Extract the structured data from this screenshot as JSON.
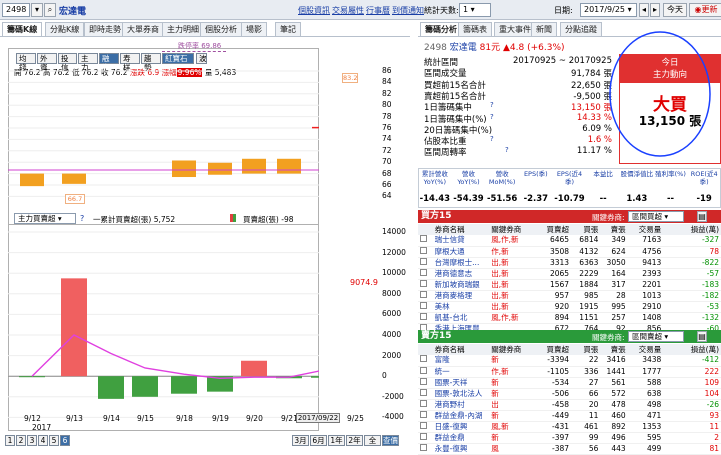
{
  "left_header": {
    "stock_id": "2498",
    "stock_name": "宏達電",
    "links": [
      "個股資訊",
      "交易屬性",
      "行事曆",
      "到價通知"
    ]
  },
  "left_tabs": [
    "籌碼K線",
    "分點K線",
    "即時走勢",
    "大單券商",
    "主力明細",
    "個股分析",
    "場影",
    "筆記"
  ],
  "chart_buttons": [
    "均錢",
    "外資",
    "投信",
    "主力",
    "融資",
    "寿样",
    "趨勢",
    "紅寶石",
    "波"
  ],
  "ohlc": {
    "open": "開 76.2",
    "high": "高 76.2",
    "low": "低 76.2",
    "close": "收 76.2",
    "change": "漲跌 6.9",
    "pct_label": "漲幅",
    "pct": "9.96%",
    "vol": "量 5,483"
  },
  "annot": {
    "limit_down": "跌停率 69.86",
    "tag_high": "83.2",
    "tag_low": "66.7"
  },
  "price_axis": [
    "86",
    "84",
    "82",
    "80",
    "78",
    "76",
    "74",
    "72",
    "70",
    "68",
    "66",
    "64"
  ],
  "lower_legend": {
    "select": "主力買賣超",
    "line": "一累計買賣超(張) 5,752",
    "bar": "買賣超(張) -98",
    "cur": "9074.9"
  },
  "lower_axis": [
    "14000",
    "12000",
    "10000",
    "8000",
    "6000",
    "4000",
    "2000",
    "0",
    "-2000",
    "-4000"
  ],
  "x_dates": [
    "9/12",
    "9/13",
    "9/14",
    "9/15",
    "9/18",
    "9/19",
    "9/20",
    "9/21",
    "9/22",
    "9/25"
  ],
  "year": "2017",
  "cursor_date": "2017/09/22",
  "pagination": {
    "pages": [
      "1",
      "2",
      "3",
      "4",
      "5",
      "6"
    ],
    "ranges": [
      "3月",
      "6月",
      "1年",
      "2年",
      "全",
      "查價"
    ]
  },
  "right_header": {
    "days_label": "統計天數:",
    "days": "1",
    "date_label": "日期:",
    "date": "2017/9/25",
    "today": "今天",
    "update": "更新"
  },
  "right_tabs": [
    "籌碼分析",
    "籌碼表",
    "重大事件",
    "新聞",
    "分點追蹤"
  ],
  "stock_line": {
    "id": "2498",
    "name": "宏達電",
    "price": "81元",
    "chg": "▲4.8 (+6.3%)"
  },
  "stats": [
    {
      "label": "統計區間",
      "value": "20170925 ~ 20170925"
    },
    {
      "label": "區間成交量",
      "value": "91,784 張"
    },
    {
      "label": "買超前15名合計",
      "value": "22,650 張"
    },
    {
      "label": "賣超前15名合計",
      "value": "-9,500 張"
    },
    {
      "label": "1日籌碼集中",
      "value": "13,150 張"
    },
    {
      "label": "1日籌碼集中(%)",
      "value": "14.33 %"
    },
    {
      "label": "20日籌碼集中(%)",
      "value": "6.09 %"
    },
    {
      "label": "佔股本比重",
      "value": "1.6 %"
    },
    {
      "label": "區間周轉率",
      "value": "11.17 %"
    }
  ],
  "today_box": {
    "t1": "今日",
    "t2": "主力動向",
    "verdict": "大買",
    "amount": "13,150 張"
  },
  "metrics_head": [
    "累計營收YoY(%)",
    "營收YoY(%)",
    "營收MoM(%)",
    "EPS(季)",
    "EPS(近4季)",
    "本益比",
    "股價淨值比",
    "殖利率(%)",
    "ROE(近4季)"
  ],
  "metrics_val": [
    "-14.43",
    "-54.39",
    "-51.56",
    "-2.37",
    "-10.79",
    "--",
    "1.43",
    "--",
    "-19"
  ],
  "buy15": {
    "title": "買方15",
    "q": "關鍵券商:",
    "select": "區間買超",
    "cols": [
      "券商名稱",
      "關鍵券商",
      "買賣超",
      "買張",
      "賣張",
      "交易量",
      "損益(萬)"
    ],
    "rows": [
      [
        "瑞士信貸",
        "風,作,新",
        "6465",
        "6814",
        "349",
        "7163",
        "-327"
      ],
      [
        "摩根大通",
        "作,新",
        "3508",
        "4132",
        "624",
        "4756",
        "78"
      ],
      [
        "台灣摩根士...",
        "出,新",
        "3313",
        "6363",
        "3050",
        "9413",
        "-822"
      ],
      [
        "港商德意志",
        "出,新",
        "2065",
        "2229",
        "164",
        "2393",
        "-57"
      ],
      [
        "新加坡商瑞銀",
        "出,新",
        "1567",
        "1884",
        "317",
        "2201",
        "-183"
      ],
      [
        "港商麥格理",
        "出,新",
        "957",
        "985",
        "28",
        "1013",
        "-182"
      ],
      [
        "美林",
        "出,新",
        "920",
        "1915",
        "995",
        "2910",
        "-53"
      ],
      [
        "凱基-台北",
        "風,作,新",
        "894",
        "1151",
        "257",
        "1408",
        "-132"
      ],
      [
        "香港上海匯豐",
        "",
        "672",
        "764",
        "92",
        "856",
        "-60"
      ]
    ]
  },
  "sell15": {
    "title": "賣方15",
    "q": "關鍵券商:",
    "select": "區間賣超",
    "cols": [
      "券商名稱",
      "關鍵券商",
      "買賣超",
      "買張",
      "賣張",
      "交易量",
      "損益(萬)"
    ],
    "rows": [
      [
        "富隆",
        "新",
        "-3394",
        "22",
        "3416",
        "3438",
        "-412"
      ],
      [
        "統一",
        "作,新",
        "-1105",
        "336",
        "1441",
        "1777",
        "222"
      ],
      [
        "國票-天祥",
        "新",
        "-534",
        "27",
        "561",
        "588",
        "109"
      ],
      [
        "國票-敦北法人",
        "新",
        "-506",
        "66",
        "572",
        "638",
        "104"
      ],
      [
        "港商野村",
        "出",
        "-458",
        "20",
        "478",
        "498",
        "-26"
      ],
      [
        "群益金鼎-內湖",
        "新",
        "-449",
        "11",
        "460",
        "471",
        "93"
      ],
      [
        "日盛-復興",
        "風,新",
        "-431",
        "461",
        "892",
        "1353",
        "11"
      ],
      [
        "群益金鼎",
        "新",
        "-397",
        "99",
        "496",
        "595",
        "2"
      ],
      [
        "永豐-復興",
        "風",
        "-387",
        "56",
        "443",
        "499",
        "81"
      ]
    ]
  },
  "candles": [
    {
      "open": 68,
      "close": 65.8
    },
    {
      "open": 68,
      "close": 66.2
    },
    {
      "open": null,
      "close": null
    },
    {
      "open": null,
      "close": null
    },
    {
      "open": 70.3,
      "close": 67.4
    },
    {
      "open": 69.9,
      "close": 67.8
    },
    {
      "open": 70.6,
      "close": 68
    },
    {
      "open": 70.6,
      "close": 68
    },
    {
      "open": 76.2,
      "close": 76.2
    },
    {
      "open": 79,
      "close": 83.2
    }
  ],
  "bars": [
    -98,
    9500,
    -2200,
    -2000,
    -1700,
    -1500,
    1500,
    -200,
    -150,
    13100
  ],
  "cumline": [
    0,
    4000,
    2200,
    800,
    200,
    -200,
    -100,
    -100,
    600,
    12000
  ]
}
